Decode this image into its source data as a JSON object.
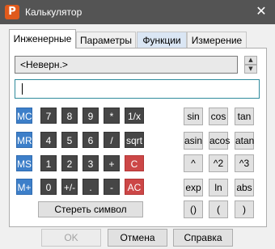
{
  "window": {
    "title": "Калькулятор",
    "app_icon_letter": "P",
    "close_glyph": "✕"
  },
  "tabs": [
    "Инженерные",
    "Параметры",
    "Функции",
    "Измерение"
  ],
  "mode_combo": {
    "value": "<Неверн.>"
  },
  "spin": {
    "up": "▲",
    "down": "▼"
  },
  "entry": {
    "value": ""
  },
  "memory_keys": [
    "MC",
    "MR",
    "MS",
    "M+"
  ],
  "keypad": [
    [
      "7",
      "8",
      "9",
      "*",
      "1/x"
    ],
    [
      "4",
      "5",
      "6",
      "/",
      "sqrt"
    ],
    [
      "1",
      "2",
      "3",
      "+",
      "C"
    ],
    [
      "0",
      "+/-",
      ".",
      "-",
      "AC"
    ]
  ],
  "function_keys": [
    [
      "sin",
      "cos",
      "tan"
    ],
    [
      "asin",
      "acos",
      "atan"
    ],
    [
      "^",
      "^2",
      "^3"
    ],
    [
      "exp",
      "ln",
      "abs"
    ],
    [
      "()",
      "(",
      ")"
    ]
  ],
  "clear_symbol_label": "Стереть символ",
  "buttons": {
    "ok": "OK",
    "cancel": "Отмена",
    "help": "Справка"
  },
  "colors": {
    "memory": "#3d7fc9",
    "digits": "#464646",
    "clear": "#cc4747",
    "titlebar": "#545454"
  }
}
